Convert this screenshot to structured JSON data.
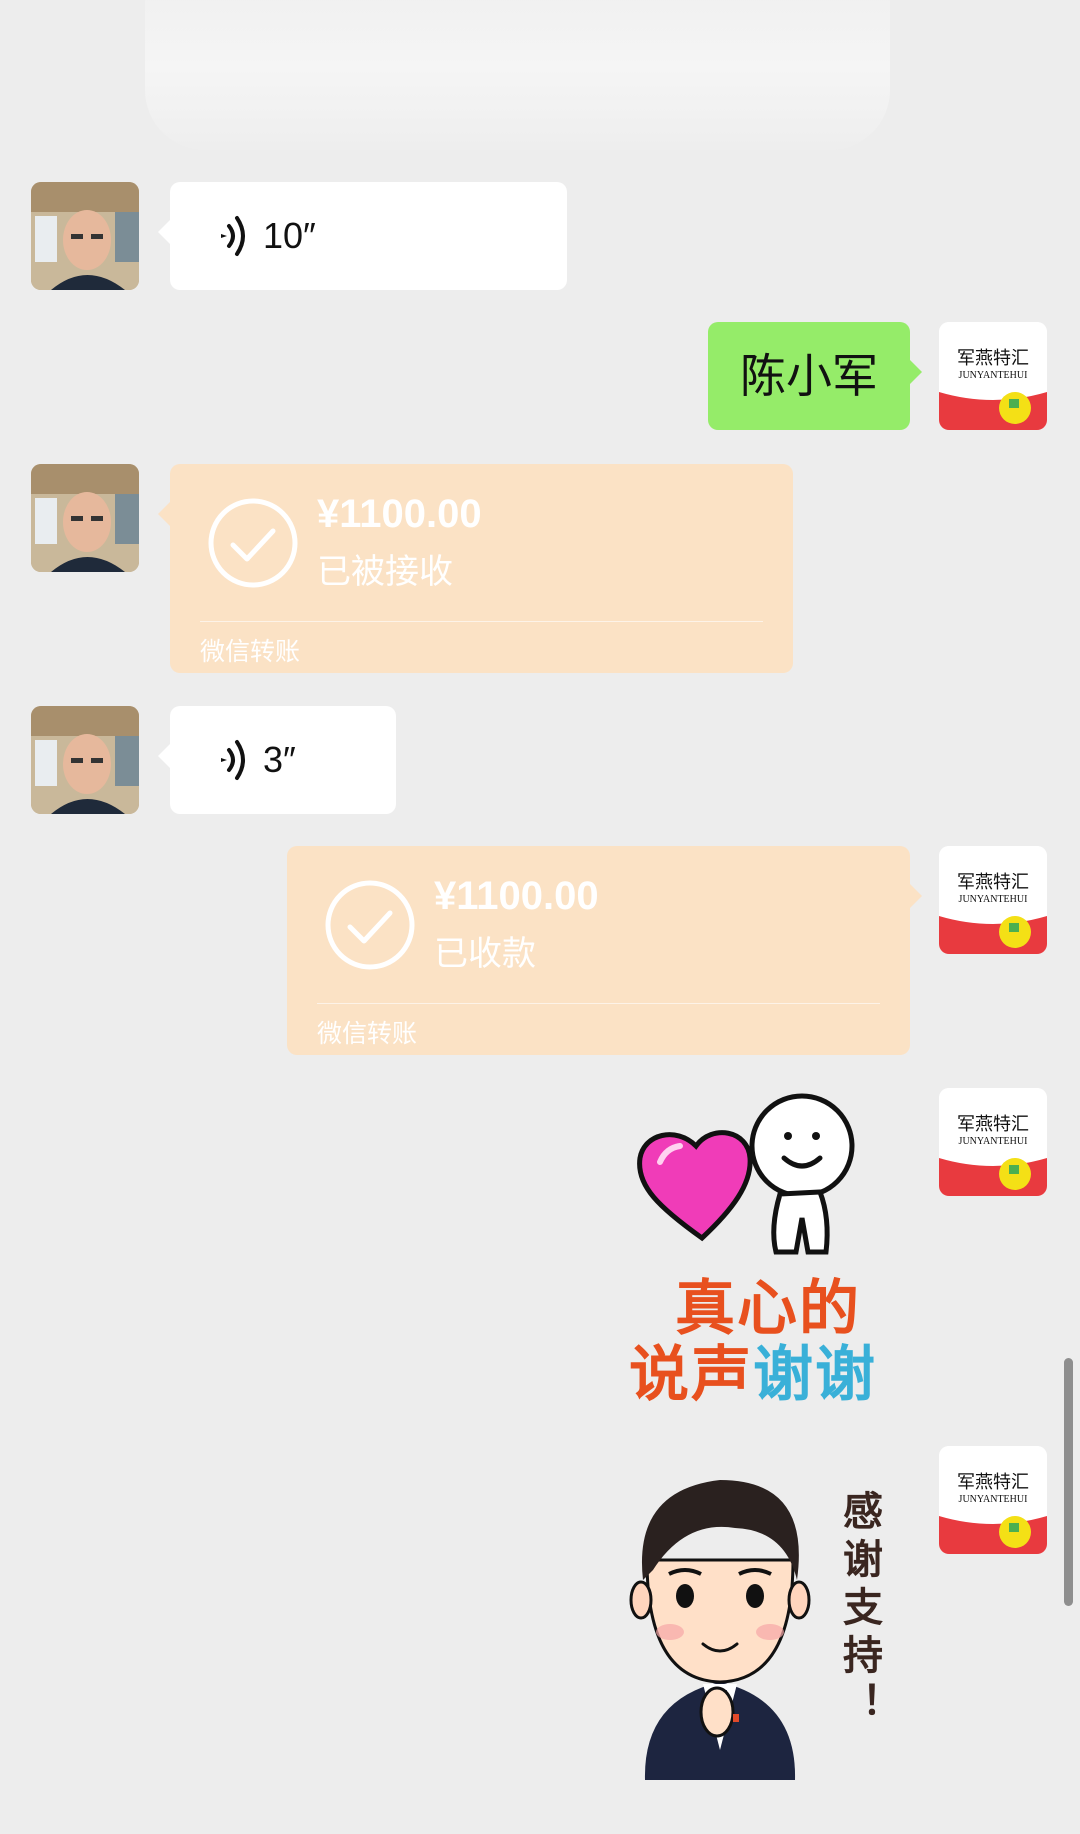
{
  "messages": {
    "voice1": {
      "duration": "10″"
    },
    "text1": {
      "text": "陈小军"
    },
    "transfer1": {
      "amount": "¥1100.00",
      "status": "已被接收",
      "source": "微信转账"
    },
    "voice2": {
      "duration": "3″"
    },
    "transfer2": {
      "amount": "¥1100.00",
      "status": "已收款",
      "source": "微信转账"
    },
    "sticker1": {
      "line1": "真心的",
      "line2_a": "说声",
      "line2_b": "谢谢"
    },
    "sticker2": {
      "text": "感谢支持！"
    }
  },
  "self_avatar": {
    "logo_cn": "军燕特汇",
    "logo_en": "JUNYANTEHUI"
  },
  "colors": {
    "background": "#ededed",
    "green_bubble": "#95ec69",
    "transfer_bubble": "#fbe2c5"
  }
}
